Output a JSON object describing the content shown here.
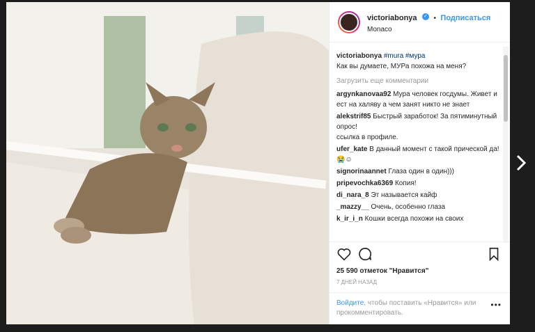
{
  "header": {
    "username": "victoriabonya",
    "dot": "•",
    "follow_label": "Подписаться",
    "location": "Monaco"
  },
  "caption": {
    "username": "victoriabonya",
    "tags": "#mura #мура",
    "text": "Как вы думаете, МУРа похожа на меня?"
  },
  "load_more_label": "Загрузить еще комментарии",
  "comments": [
    {
      "user": "argynkanovaa92",
      "text": "Мура человек госдумы. Живет и ест на халяву а чем занят никто не знает"
    },
    {
      "user": "alekstrif85",
      "text": "Быстрый заработок! За пятиминутный опрос!\nссылка в профиле."
    },
    {
      "user": "ufer_kate",
      "text": "В данный момент с такой прической да!😭☺"
    },
    {
      "user": "signorinaannet",
      "text": "Глаза один в один)))"
    },
    {
      "user": "pripevochka6369",
      "text": "Копия!"
    },
    {
      "user": "di_nara_8",
      "text": "Эт называется кайф"
    },
    {
      "user": "_mazzy__",
      "text": "Очень, особенно глаза"
    },
    {
      "user": "k_ir_i_n",
      "text": "Кошки всегда похожи на своих"
    }
  ],
  "likes_text": "25 590 отметок \"Нравится\"",
  "time_text": "7 ДНЕЙ НАЗАД",
  "footer": {
    "login_link": "Войдите",
    "text": ", чтобы поставить «Нравится» или прокомментировать.",
    "more": "•••"
  },
  "next_icon": "chevron-right-icon"
}
